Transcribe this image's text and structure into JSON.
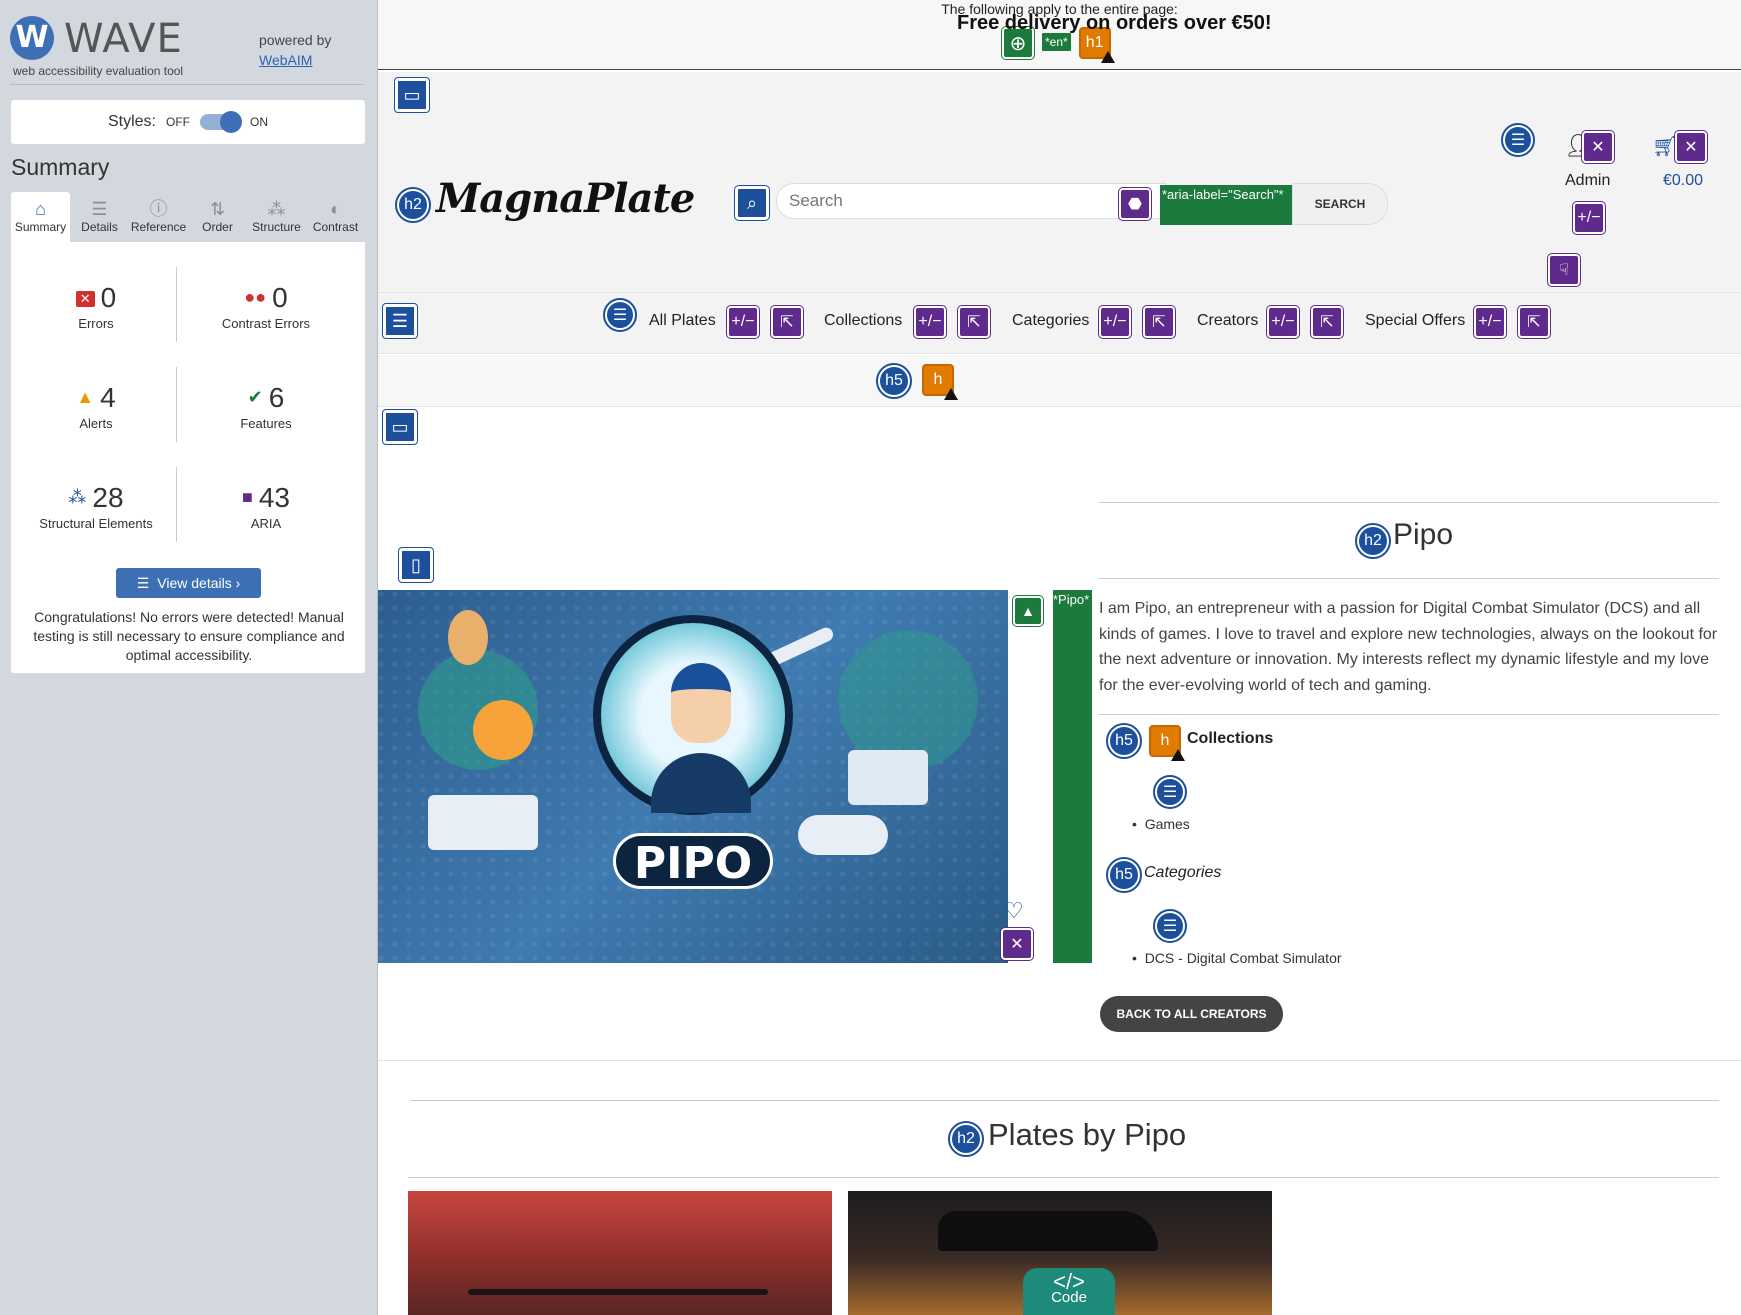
{
  "wave": {
    "logo_letter": "W",
    "name": "WAVE",
    "tagline": "web accessibility evaluation tool",
    "powered_by": "powered by",
    "powered_link": "WebAIM",
    "styles_label": "Styles:",
    "styles_off": "OFF",
    "styles_on": "ON",
    "summary_title": "Summary",
    "tabs": [
      {
        "label": "Summary",
        "icon": "home-icon"
      },
      {
        "label": "Details",
        "icon": "list-icon"
      },
      {
        "label": "Reference",
        "icon": "info-icon"
      },
      {
        "label": "Order",
        "icon": "order-icon"
      },
      {
        "label": "Structure",
        "icon": "structure-icon"
      },
      {
        "label": "Contrast",
        "icon": "contrast-icon"
      }
    ],
    "stats": {
      "errors": {
        "value": "0",
        "label": "Errors"
      },
      "contrast_errors": {
        "value": "0",
        "label": "Contrast Errors"
      },
      "alerts": {
        "value": "4",
        "label": "Alerts"
      },
      "features": {
        "value": "6",
        "label": "Features"
      },
      "structural": {
        "value": "28",
        "label": "Structural Elements"
      },
      "aria": {
        "value": "43",
        "label": "ARIA"
      }
    },
    "view_details": "View details ›",
    "congrats": "Congratulations! No errors were detected! Manual testing is still necessary to ensure compliance and optimal accessibility."
  },
  "page": {
    "apply_text": "The following apply to the entire page:",
    "lang_badge": "*en*",
    "h1_badge": "h1",
    "h2_badge": "h2",
    "h5_badge": "h5",
    "h_badge": "h",
    "aria_pm": "+/−",
    "logo": "MagnaPlate",
    "search_placeholder": "Search",
    "aria_label_badge": "*aria-label=\"Search\"*",
    "search_button": "SEARCH",
    "admin": "Admin",
    "cart_total": "€0.00",
    "nav": [
      "All Plates",
      "Collections",
      "Categories",
      "Creators",
      "Special Offers"
    ],
    "promo": "Free delivery on orders over €50!",
    "creator": {
      "name": "Pipo",
      "image_alt_badge": "*Pipo*",
      "image_word": "PIPO",
      "description": "I am Pipo, an entrepreneur with a passion for Digital Combat Simulator (DCS) and all kinds of games. I love to travel and explore new technologies, always on the lookout for the next adventure or innovation. My interests reflect my dynamic lifestyle and my love for the ever-evolving world of tech and gaming.",
      "collections_label": "Collections",
      "collections": [
        "Games"
      ],
      "categories_label": "Categories",
      "categories": [
        "DCS - Digital Combat Simulator"
      ],
      "back_button": "BACK TO ALL CREATORS"
    },
    "plates_title": "Plates by Pipo",
    "code_tab": "</>",
    "code_label": "Code"
  },
  "colors": {
    "wave_blue": "#3d6fb4",
    "feature_green": "#1c7a3c",
    "alert_orange": "#e07b00",
    "aria_purple": "#5e2b8c",
    "structure_blue": "#1c4f9c"
  }
}
